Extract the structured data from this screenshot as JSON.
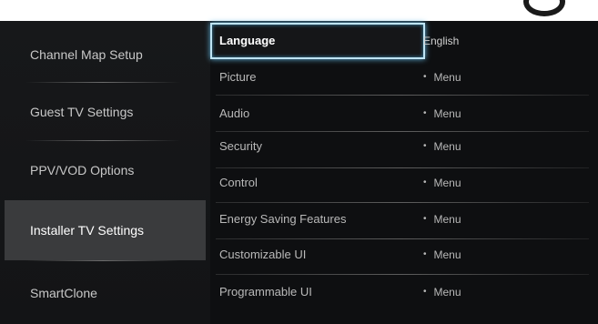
{
  "left_menu": {
    "items": [
      {
        "label": "Channel Map Setup",
        "active": false
      },
      {
        "label": "Guest TV Settings",
        "active": false
      },
      {
        "label": "PPV/VOD Options",
        "active": false
      },
      {
        "label": "Installer TV Settings",
        "active": true
      },
      {
        "label": "SmartClone",
        "active": false
      }
    ]
  },
  "right_panel": {
    "rows": [
      {
        "label": "Language",
        "value": "English",
        "bullet": ""
      },
      {
        "label": "Picture",
        "value": "Menu",
        "bullet": "•"
      },
      {
        "label": "Audio",
        "value": "Menu",
        "bullet": "•"
      },
      {
        "label": "Security",
        "value": "Menu",
        "bullet": "•"
      },
      {
        "label": "Control",
        "value": "Menu",
        "bullet": "•"
      },
      {
        "label": "Energy Saving Features",
        "value": "Menu",
        "bullet": "•"
      },
      {
        "label": "Customizable UI",
        "value": "Menu",
        "bullet": "•"
      },
      {
        "label": "Programmable UI",
        "value": "Menu",
        "bullet": "•"
      }
    ]
  },
  "colors": {
    "focus_border": "#bfe4f4",
    "active_item_bg": "#3a3b3d",
    "background": "#0f1012"
  }
}
